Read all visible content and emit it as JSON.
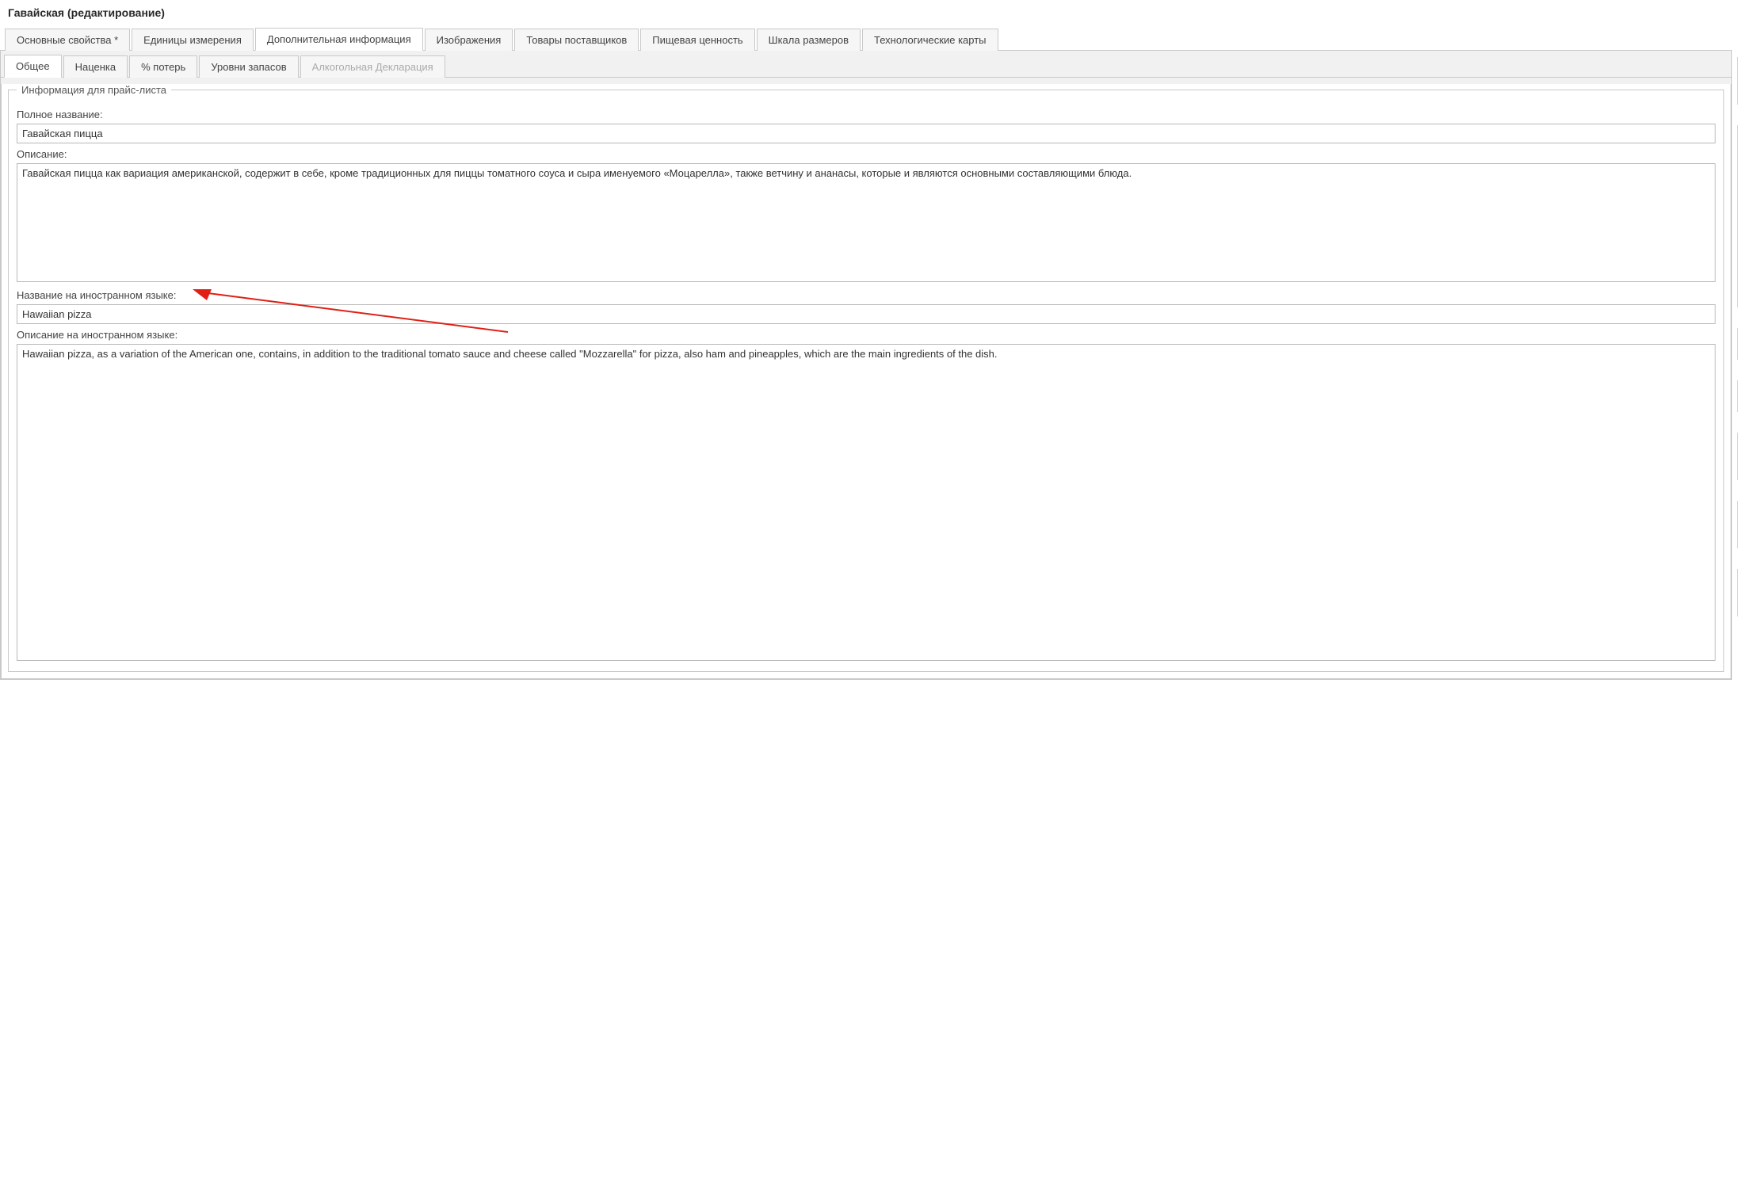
{
  "window": {
    "title": "Гавайская (редактирование)"
  },
  "main_tabs": [
    {
      "label": "Основные свойства *",
      "active": false
    },
    {
      "label": "Единицы измерения",
      "active": false
    },
    {
      "label": "Дополнительная информация",
      "active": true
    },
    {
      "label": "Изображения",
      "active": false
    },
    {
      "label": "Товары поставщиков",
      "active": false
    },
    {
      "label": "Пищевая ценность",
      "active": false
    },
    {
      "label": "Шкала размеров",
      "active": false
    },
    {
      "label": "Технологические карты",
      "active": false
    }
  ],
  "sub_tabs": [
    {
      "label": "Общее",
      "active": true,
      "disabled": false
    },
    {
      "label": "Наценка",
      "active": false,
      "disabled": false
    },
    {
      "label": "% потерь",
      "active": false,
      "disabled": false
    },
    {
      "label": "Уровни запасов",
      "active": false,
      "disabled": false
    },
    {
      "label": "Алкогольная Декларация",
      "active": false,
      "disabled": true
    }
  ],
  "fieldset": {
    "legend": "Информация для прайс-листа",
    "full_name_label": "Полное название:",
    "full_name_value": "Гавайская пицца",
    "description_label": "Описание:",
    "description_value": "Гавайская пицца как вариация американской, содержит в себе, кроме традиционных для пиццы томатного соуса и сыра именуемого «Моцарелла», также ветчину и ананасы, которые и являются основными составляющими блюда.",
    "foreign_name_label": "Название на иностранном языке:",
    "foreign_name_value": "Hawaiian pizza",
    "foreign_description_label": "Описание на иностранном языке:",
    "foreign_description_value": "Hawaiian pizza, as a variation of the American one, contains, in addition to the traditional tomato sauce and cheese called \"Mozzarella\" for pizza, also ham and pineapples, which are the main ingredients of the dish."
  }
}
